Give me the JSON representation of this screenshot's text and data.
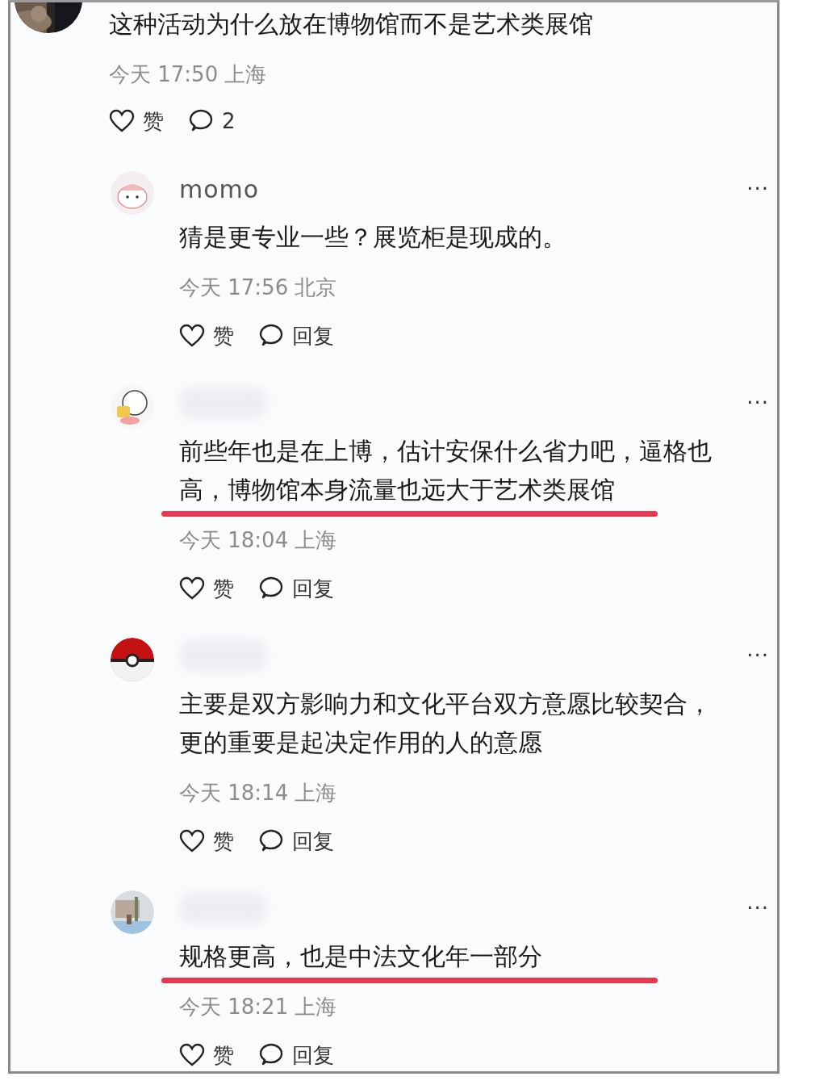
{
  "post": {
    "text": "这种活动为什么放在博物馆而不是艺术类展馆",
    "meta": "今天 17:50 上海",
    "like_label": "赞",
    "reply_count": "2"
  },
  "replies": [
    {
      "avatar": {
        "kind": "bun"
      },
      "name": "momo",
      "text": "猜是更专业一些？展览柜是现成的。",
      "meta": "今天 17:56 北京",
      "like_label": "赞",
      "reply_label": "回复",
      "more": "···",
      "underlined": false
    },
    {
      "avatar": {
        "kind": "cartoon"
      },
      "text": "前些年也是在上博，估计安保什么省力吧，逼格也高，博物馆本身流量也远大于艺术类展馆",
      "meta": "今天 18:04 上海",
      "like_label": "赞",
      "reply_label": "回复",
      "more": "···",
      "underlined": true
    },
    {
      "avatar": {
        "kind": "ball"
      },
      "text": "主要是双方影响力和文化平台双方意愿比较契合，更的重要是起决定作用的人的意愿",
      "meta": "今天 18:14 上海",
      "like_label": "赞",
      "reply_label": "回复",
      "more": "···",
      "underlined": false
    },
    {
      "text": "规格更高，也是中法文化年一部分",
      "meta": "今天 18:21 上海",
      "like_label": "赞",
      "reply_label": "回复",
      "more": "···",
      "underlined": true
    }
  ]
}
